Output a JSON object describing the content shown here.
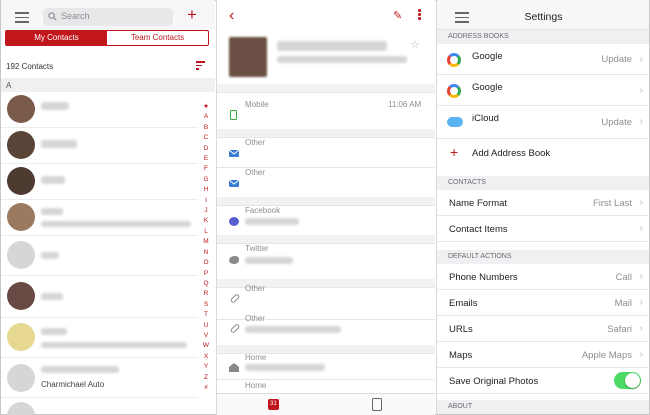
{
  "contacts_list": {
    "search_placeholder": "Search",
    "add_label": "+",
    "segments": [
      "My Contacts",
      "Team Contacts"
    ],
    "count_label": "192 Contacts",
    "section_letter": "A",
    "visible_subtitle": "Charmichael Auto",
    "alpha_index": [
      "★",
      "A",
      "B",
      "C",
      "D",
      "E",
      "F",
      "G",
      "H",
      "I",
      "J",
      "K",
      "L",
      "M",
      "N",
      "O",
      "P",
      "Q",
      "R",
      "S",
      "T",
      "U",
      "V",
      "W",
      "X",
      "Y",
      "Z",
      "#"
    ]
  },
  "contact_detail": {
    "back_glyph": "‹",
    "edit_glyph": "✎",
    "favorite_glyph": "☆",
    "fields": [
      {
        "label": "Mobile",
        "time": "11:06 AM",
        "icon": "phone-icon"
      },
      {
        "label": "Other",
        "icon": "mail-icon"
      },
      {
        "label": "Other",
        "icon": "mail-icon"
      },
      {
        "label": "Facebook",
        "icon": "chat-icon"
      },
      {
        "label": "Twitter",
        "icon": "bird-icon"
      },
      {
        "label": "Other",
        "icon": "link-icon"
      },
      {
        "label": "Other",
        "icon": "link-icon"
      },
      {
        "label": "Home",
        "icon": "house-icon"
      },
      {
        "label": "Home",
        "icon": "house-icon"
      }
    ],
    "footer_tab_badge": "31"
  },
  "settings": {
    "title": "Settings",
    "address_books_header": "ADDRESS BOOKS",
    "address_books": [
      {
        "name": "Google",
        "value": "Update",
        "icon": "google-icon"
      },
      {
        "name": "Google",
        "value": "",
        "icon": "google-icon"
      },
      {
        "name": "iCloud",
        "value": "Update",
        "icon": "cloud-icon"
      }
    ],
    "add_address_book": "Add Address Book",
    "contacts_header": "CONTACTS",
    "contacts_rows": [
      {
        "label": "Name Format",
        "value": "First Last"
      },
      {
        "label": "Contact Items",
        "value": ""
      }
    ],
    "default_actions_header": "DEFAULT ACTIONS",
    "default_actions": [
      {
        "label": "Phone Numbers",
        "value": "Call"
      },
      {
        "label": "Emails",
        "value": "Mail"
      },
      {
        "label": "URLs",
        "value": "Safari"
      },
      {
        "label": "Maps",
        "value": "Apple Maps"
      }
    ],
    "save_photos_label": "Save Original Photos",
    "save_photos_on": true,
    "about_header": "ABOUT",
    "accent_color": "#c0161c",
    "toggle_color": "#4cd964"
  }
}
